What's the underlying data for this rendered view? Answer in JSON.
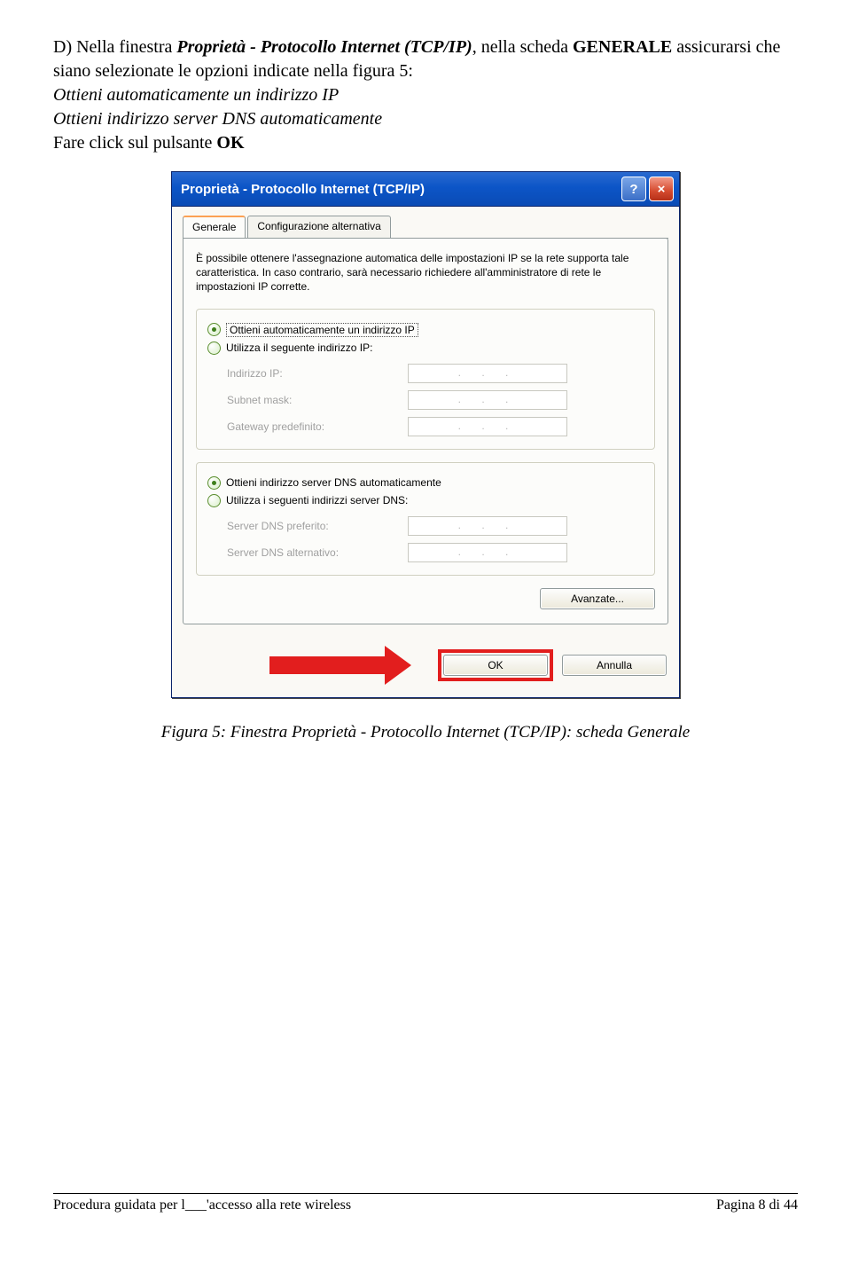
{
  "instruction": {
    "lead": "D) Nella finestra ",
    "window_name": "Proprietà - Protocollo Internet (TCP/IP)",
    "mid1": ", nella scheda ",
    "tab_name": "GENERALE",
    "mid2": " assicurarsi che siano selezionate le opzioni indicate nella figura 5:",
    "opt1": "Ottieni automaticamente un indirizzo IP",
    "opt2": "Ottieni indirizzo server DNS automaticamente",
    "tail1": "Fare click sul pulsante ",
    "ok": "OK"
  },
  "dialog": {
    "title": "Proprietà - Protocollo Internet (TCP/IP)",
    "help_btn": "?",
    "close_btn": "×",
    "tabs": {
      "general": "Generale",
      "alt": "Configurazione alternativa"
    },
    "desc": "È possibile ottenere l'assegnazione automatica delle impostazioni IP se la rete supporta tale caratteristica. In caso contrario, sarà necessario richiedere all'amministratore di rete le impostazioni IP corrette.",
    "ip_group": {
      "auto": "Ottieni automaticamente un indirizzo IP",
      "manual": "Utilizza il seguente indirizzo IP:",
      "fields": {
        "ip": "Indirizzo IP:",
        "subnet": "Subnet mask:",
        "gateway": "Gateway predefinito:"
      }
    },
    "dns_group": {
      "auto": "Ottieni indirizzo server DNS automaticamente",
      "manual": "Utilizza i seguenti indirizzi server DNS:",
      "fields": {
        "pref": "Server DNS preferito:",
        "alt": "Server DNS alternativo:"
      }
    },
    "ip_dots": ".  .  .",
    "advanced": "Avanzate...",
    "ok": "OK",
    "cancel": "Annulla"
  },
  "caption": "Figura 5: Finestra Proprietà - Protocollo Internet (TCP/IP): scheda Generale",
  "footer": {
    "left": "Procedura guidata per l___'accesso alla rete wireless",
    "right": "Pagina 8 di 44"
  }
}
